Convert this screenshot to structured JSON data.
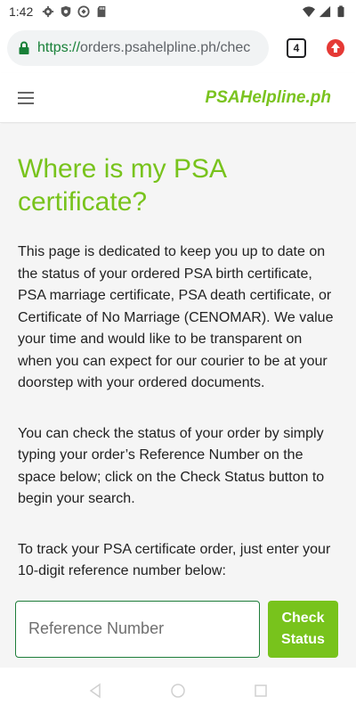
{
  "status_bar": {
    "time": "1:42",
    "left_icons": [
      "gear-icon",
      "shield-icon",
      "at-sign-icon",
      "sd-card-icon"
    ],
    "right_icons": [
      "wifi-icon",
      "signal-icon",
      "battery-icon"
    ]
  },
  "browser": {
    "url_scheme": "https://",
    "url_rest": "orders.psahelpline.ph/chec",
    "tab_count": "4",
    "update_icon": "arrow-up-circle-icon",
    "colors": {
      "https": "#188038",
      "update": "#e53935"
    }
  },
  "header": {
    "brand": "PSAHelpline.ph",
    "menu_icon": "hamburger-menu-icon"
  },
  "main": {
    "title": "Where is my PSA certificate?",
    "para1": "This page is dedicated to keep you up to date on the status of your ordered PSA birth certificate, PSA marriage certificate, PSA death certificate, or Certificate of No Marriage (CENOMAR). We value your time and would like to be transparent on when you can expect for our courier to be at your doorstep with your ordered documents.",
    "para2": "You can check the status of your order by simply typing your order’s Reference Number on the space below; click on the Check Status button to begin your search.",
    "para3": "To track your PSA certificate order, just enter your 10-digit reference number below:",
    "reference_input": {
      "placeholder": "Reference Number",
      "value": ""
    },
    "check_button": "Check Status",
    "colors": {
      "accent": "#78c31c",
      "input_border": "#1e7d3a",
      "background": "#f5f5f5"
    }
  },
  "nav_bar": {
    "icons": [
      "back-icon",
      "home-icon",
      "recents-icon"
    ]
  }
}
